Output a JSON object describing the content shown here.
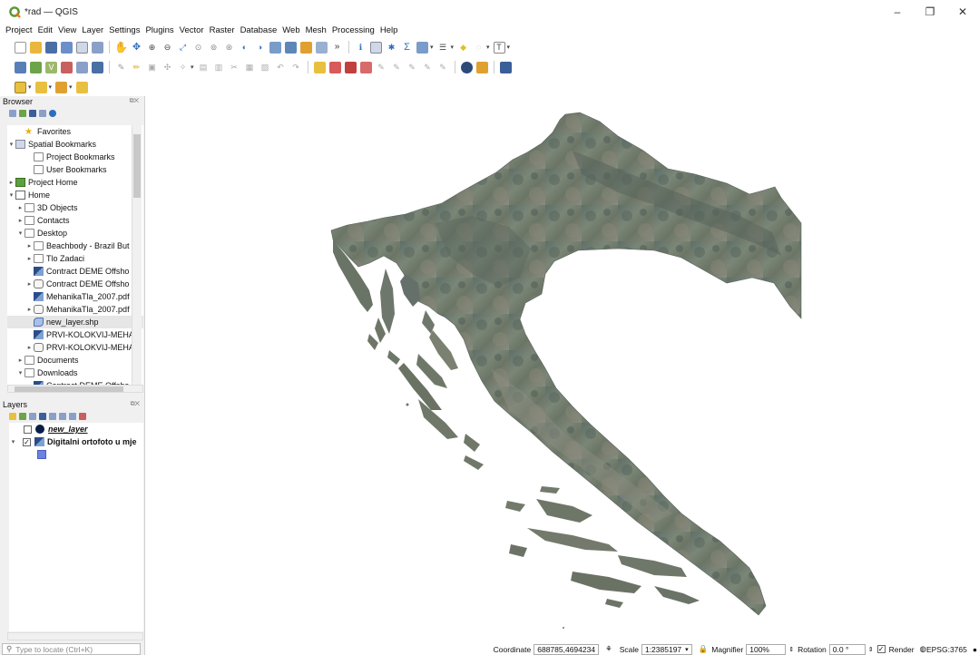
{
  "window": {
    "title": "*rad — QGIS",
    "minimize": "–",
    "restore": "❐",
    "close": "✕"
  },
  "menus": [
    "Project",
    "Edit",
    "View",
    "Layer",
    "Settings",
    "Plugins",
    "Vector",
    "Raster",
    "Database",
    "Web",
    "Mesh",
    "Processing",
    "Help"
  ],
  "browser": {
    "title": "Browser",
    "items": [
      {
        "label": "Favorites",
        "arrow": "",
        "icon": "star",
        "indent": 1
      },
      {
        "label": "Spatial Bookmarks",
        "arrow": "▾",
        "icon": "bookmark",
        "indent": 0
      },
      {
        "label": "Project Bookmarks",
        "arrow": "",
        "icon": "folder",
        "indent": 2
      },
      {
        "label": "User Bookmarks",
        "arrow": "",
        "icon": "folder",
        "indent": 2
      },
      {
        "label": "Project Home",
        "arrow": "▸",
        "icon": "green",
        "indent": 0
      },
      {
        "label": "Home",
        "arrow": "▾",
        "icon": "home",
        "indent": 0
      },
      {
        "label": "3D Objects",
        "arrow": "▸",
        "icon": "folder",
        "indent": 1
      },
      {
        "label": "Contacts",
        "arrow": "▸",
        "icon": "folder",
        "indent": 1
      },
      {
        "label": "Desktop",
        "arrow": "▾",
        "icon": "folder",
        "indent": 1
      },
      {
        "label": "Beachbody - Brazil But",
        "arrow": "▸",
        "icon": "folder",
        "indent": 2
      },
      {
        "label": "Tlo Zadaci",
        "arrow": "▸",
        "icon": "folder",
        "indent": 2
      },
      {
        "label": "Contract DEME Offsho",
        "arrow": "",
        "icon": "raster",
        "indent": 2
      },
      {
        "label": "Contract DEME Offsho",
        "arrow": "▸",
        "icon": "db",
        "indent": 2
      },
      {
        "label": "MehanikaTla_2007.pdf",
        "arrow": "",
        "icon": "raster",
        "indent": 2
      },
      {
        "label": "MehanikaTla_2007.pdf",
        "arrow": "▸",
        "icon": "db",
        "indent": 2
      },
      {
        "label": "new_layer.shp",
        "arrow": "",
        "icon": "poly",
        "indent": 2,
        "selected": true
      },
      {
        "label": "PRVI-KOLOKVIJ-MEHA",
        "arrow": "",
        "icon": "raster",
        "indent": 2
      },
      {
        "label": "PRVI-KOLOKVIJ-MEHA",
        "arrow": "▸",
        "icon": "db",
        "indent": 2
      },
      {
        "label": "Documents",
        "arrow": "▸",
        "icon": "folder",
        "indent": 1
      },
      {
        "label": "Downloads",
        "arrow": "▾",
        "icon": "folder",
        "indent": 1
      },
      {
        "label": "Contract DEME Offsho",
        "arrow": "",
        "icon": "raster",
        "indent": 2
      }
    ]
  },
  "layers": {
    "title": "Layers",
    "items": [
      {
        "label": "new_layer",
        "checked": false,
        "icon": "dot"
      },
      {
        "label": "Digitalni ortofoto u mje",
        "checked": true,
        "icon": "raster"
      }
    ]
  },
  "locate_placeholder": "Type to locate (Ctrl+K)",
  "status": {
    "coordinate_label": "Coordinate",
    "coordinate": "688785,4694234",
    "scale_label": "Scale",
    "scale": "1:2385197",
    "magnifier_label": "Magnifier",
    "magnifier": "100%",
    "rotation_label": "Rotation",
    "rotation": "0.0 °",
    "render_label": "Render",
    "crs": "EPSG:3765"
  },
  "colors": {
    "accent": "#589632",
    "panel": "#f0f0f0",
    "map": "#6f7a6c"
  }
}
